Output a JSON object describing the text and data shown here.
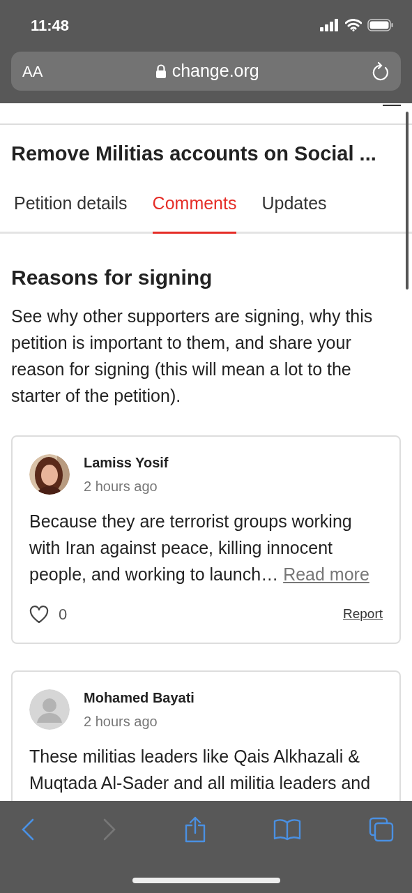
{
  "status_bar": {
    "time": "11:48"
  },
  "address_bar": {
    "text_size_button": "AA",
    "url": "change.org"
  },
  "petition": {
    "title": "Remove Militias accounts on Social ..."
  },
  "tabs": [
    {
      "label": "Petition details",
      "selected": false
    },
    {
      "label": "Comments",
      "selected": true
    },
    {
      "label": "Updates",
      "selected": false
    }
  ],
  "section": {
    "heading": "Reasons for signing",
    "intro": "See why other supporters are signing, why this petition is important to them, and share your reason for signing (this will mean a lot to the starter of the petition)."
  },
  "comments": [
    {
      "author": "Lamiss Yosif",
      "time": "2 hours ago",
      "has_photo": true,
      "text": "Because they are terrorist groups working with Iran against peace, killing innocent people, and working to launch…",
      "read_more": "Read more",
      "likes": "0",
      "report": "Report"
    },
    {
      "author": "Mohamed Bayati",
      "time": "2 hours ago",
      "has_photo": false,
      "text": "These militias leaders like Qais Alkhazali & Muqtada Al-Sader and all militia leaders and"
    }
  ],
  "toolbar": {
    "back_enabled": true,
    "forward_enabled": false
  }
}
